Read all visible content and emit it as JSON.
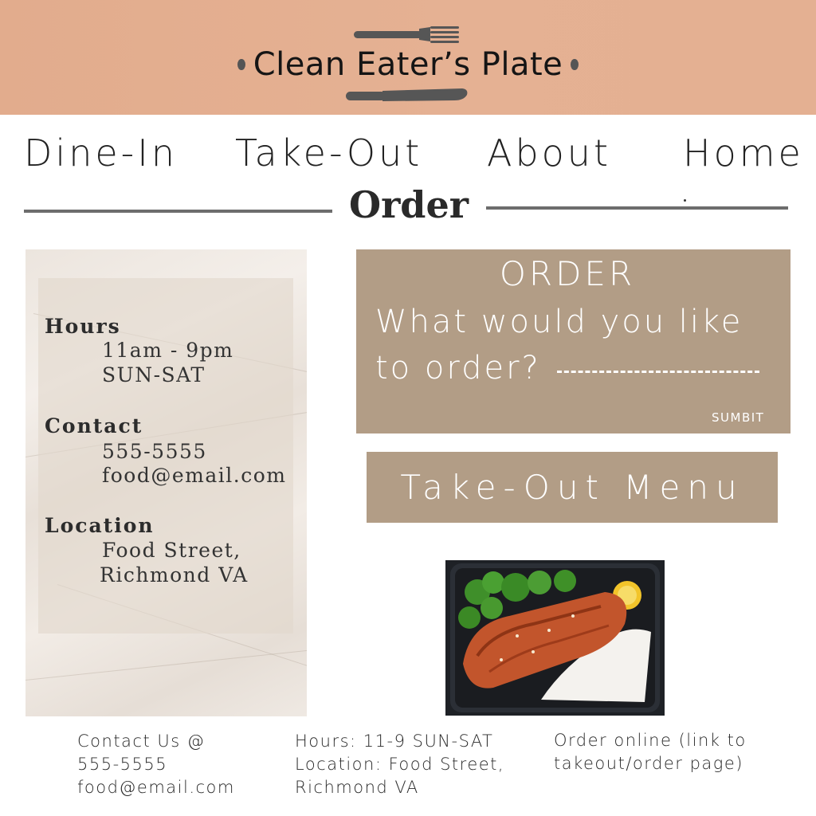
{
  "header": {
    "title": "Clean Eater’s Plate",
    "background_color": "#e3ae8f",
    "icons": [
      "fork-icon",
      "knife-icon"
    ]
  },
  "nav": {
    "items": [
      {
        "label": "Dine-In"
      },
      {
        "label": "Take-Out"
      },
      {
        "label": "About"
      },
      {
        "label": "Home"
      }
    ]
  },
  "section": {
    "title": "Order"
  },
  "info_card": {
    "hours_label": "Hours",
    "hours_time": "11am - 9pm",
    "hours_days": "SUN-SAT",
    "contact_label": "Contact",
    "contact_phone": "555-5555",
    "contact_email": "food@email.com",
    "location_label": "Location",
    "location_street": "Food Street,",
    "location_city": "Richmond VA"
  },
  "order_form": {
    "heading": "ORDER",
    "question_line1": "What would you like",
    "question_line2": "to order?",
    "submit_label": "SUMBIT",
    "box_color": "#b29d86"
  },
  "takeout_menu": {
    "label": "Take-Out Menu"
  },
  "photo": {
    "icon": "salmon-meal-photo"
  },
  "footer": {
    "col1": [
      "Contact Us @",
      "555-5555",
      "food@email.com"
    ],
    "col2": [
      "Hours: 11-9 SUN-SAT",
      "Location: Food Street,",
      "Richmond VA"
    ],
    "col3": [
      "Order online (link to",
      "takeout/order page)"
    ]
  }
}
